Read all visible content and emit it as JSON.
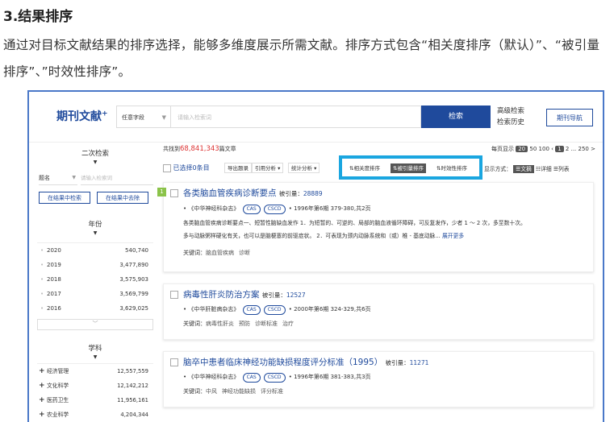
{
  "doc": {
    "heading": "3.结果排序",
    "paragraph": "通过对目标文献结果的排序选择，能够多维度展示所需文献。排序方式包含“相关度排序（默认）”、“被引量排序”、”时效性排序”。"
  },
  "header": {
    "logo": "期刊文献",
    "logo_sup": "+",
    "field_select": "任意字段",
    "search_placeholder": "请输入检索词",
    "search_button": "检索",
    "advanced_search": "高级检索",
    "search_history": "检索历史",
    "journal_nav": "期刊导航"
  },
  "sidebar": {
    "secondary_title": "二次检索",
    "secondary_field": "题名",
    "secondary_placeholder": "请输入检索词",
    "search_in_results": "在结果中检索",
    "exclude_from_results": "在结果中去除",
    "year_title": "年份",
    "years": [
      {
        "year": "2020",
        "count": "540,740"
      },
      {
        "year": "2019",
        "count": "3,477,890"
      },
      {
        "year": "2018",
        "count": "3,575,903"
      },
      {
        "year": "2017",
        "count": "3,569,799"
      },
      {
        "year": "2016",
        "count": "3,629,025"
      }
    ],
    "subject_title": "学科",
    "subjects": [
      {
        "name": "经济管理",
        "count": "12,557,559"
      },
      {
        "name": "文化科学",
        "count": "12,142,212"
      },
      {
        "name": "医药卫生",
        "count": "11,956,161"
      },
      {
        "name": "农业科学",
        "count": "4,204,344"
      }
    ]
  },
  "results": {
    "found_prefix": "共找到",
    "found_count": "68,841,343",
    "found_suffix": "篇文章",
    "page_size_label": "每页显示",
    "page_sizes": [
      "20",
      "50",
      "100"
    ],
    "pages": [
      "1",
      "2",
      "...",
      "250",
      ">"
    ],
    "selected_label": "已选择0条目",
    "export": "导出题录",
    "citation_analysis": "引用分析 ▾",
    "stats_analysis": "统计分析 ▾",
    "sort_relevance": "相关度排序",
    "sort_citations": "被引量排序",
    "sort_recency": "时效性排序",
    "display_label": "显示方式：",
    "display_abstract": "文摘",
    "display_detail": "详细",
    "display_list": "列表",
    "items": [
      {
        "title": "各类脑血管疾病诊断要点",
        "cite_label": "被引量：",
        "cite_count": "28889",
        "journal": "《中华神经科杂志》",
        "tags": [
          "CAS",
          "CSCD"
        ],
        "issue": "• 1996年第6期 379-380,共2页",
        "abstract_1": "各类脑血管疾病诊断要点一、短暂性脑缺血发作 1．为短暂的、可逆的、局部的脑血液循环障碍，可反复发作，少者 1 ～ 2 次，多至数十次。",
        "abstract_2": "多与动脉粥样硬化有关，也可以是脑梗塞的前驱症状。 2．可表现为颈内动脉系统和（或）椎 - 基底动脉...",
        "expand": "展开更多",
        "kw_label": "关键词：",
        "keywords": [
          "脑血管疾病",
          "诊断"
        ]
      },
      {
        "title": "病毒性肝炎防治方案",
        "cite_label": "被引量：",
        "cite_count": "12527",
        "journal": "《中华肝脏病杂志》",
        "tags": [
          "CAS",
          "CSCD"
        ],
        "issue": "• 2000年第6期 324-329,共6页",
        "kw_label": "关键词：",
        "keywords": [
          "病毒性肝炎",
          "预防",
          "诊断标准",
          "治疗"
        ]
      },
      {
        "title": "脑卒中患者临床神经功能缺损程度评分标准（1995）",
        "cite_label": "被引量：",
        "cite_count": "11271",
        "journal": "《中华神经科杂志》",
        "tags": [
          "CAS",
          "CSCD"
        ],
        "issue": "• 1996年第6期 381-383,共3页",
        "kw_label": "关键词：",
        "keywords": [
          "中风",
          "神经功能缺损",
          "评分标准"
        ]
      }
    ]
  },
  "colors": {
    "brand": "#1f4a9c",
    "highlight": "#1aa6e0",
    "count_red": "#dd3333"
  }
}
